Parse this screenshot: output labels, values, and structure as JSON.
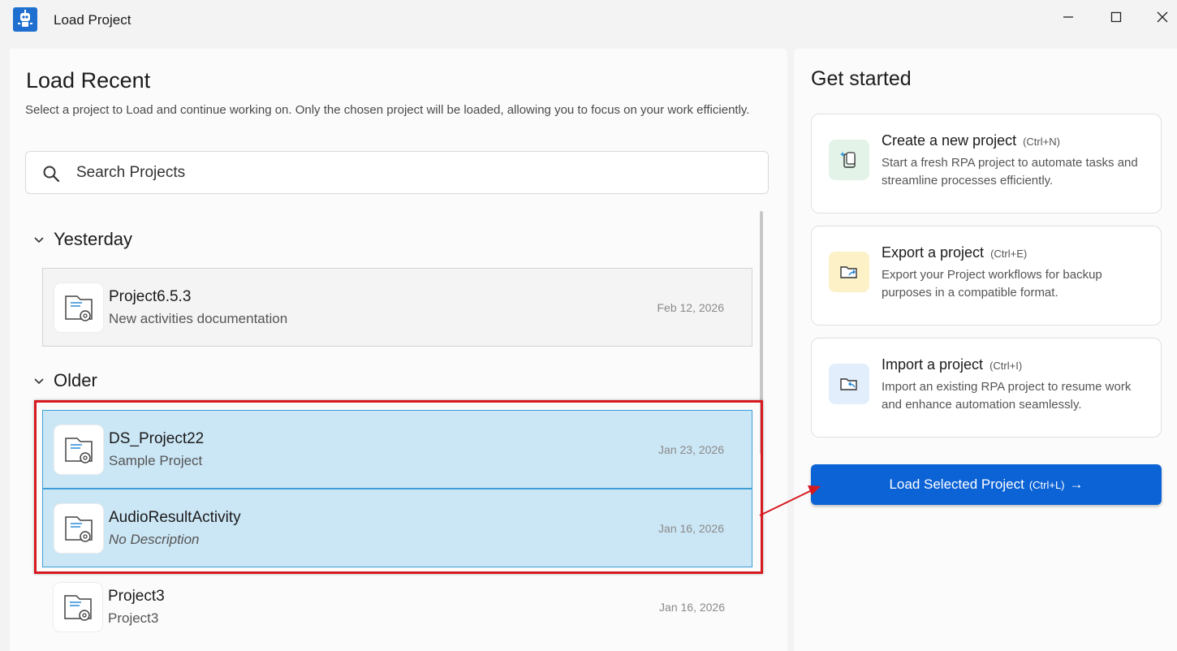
{
  "window": {
    "title": "Load Project"
  },
  "left": {
    "heading": "Load Recent",
    "subtitle": "Select a project to Load and continue working on. Only the chosen project will be loaded, allowing you to focus on your work efficiently.",
    "search": {
      "placeholder": "Search Projects",
      "value": ""
    },
    "groups": [
      {
        "label": "Yesterday",
        "items": [
          {
            "name": "Project6.5.3",
            "description": "New activities documentation",
            "date": "Feb 12, 2026",
            "state": "hover"
          }
        ]
      },
      {
        "label": "Older",
        "items": [
          {
            "name": "DS_Project22",
            "description": "Sample Project",
            "date": "Jan 23, 2026",
            "state": "selected"
          },
          {
            "name": "AudioResultActivity",
            "description": "No Description",
            "date": "Jan 16, 2026",
            "state": "selected"
          },
          {
            "name": "Project3",
            "description": "Project3",
            "date": "Jan 16, 2026",
            "state": "normal"
          }
        ]
      }
    ]
  },
  "right": {
    "heading": "Get started",
    "cards": [
      {
        "title": "Create a new project",
        "shortcut": "(Ctrl+N)",
        "description": "Start a fresh RPA project to automate tasks and streamline processes efficiently.",
        "icon": "new-project-icon",
        "tile_color": "#e3f3e8"
      },
      {
        "title": "Export a project",
        "shortcut": "(Ctrl+E)",
        "description": "Export your Project workflows for backup purposes in a compatible format.",
        "icon": "export-folder-icon",
        "tile_color": "#fdf1c8"
      },
      {
        "title": "Import a project",
        "shortcut": "(Ctrl+I)",
        "description": "Import an existing RPA project to resume work and enhance automation seamlessly.",
        "icon": "import-folder-icon",
        "tile_color": "#e2eefc"
      }
    ],
    "load_button": {
      "label": "Load Selected Project",
      "shortcut": "(Ctrl+L)",
      "arrow": "→"
    }
  },
  "colors": {
    "accent": "#0c63d6",
    "selected_bg": "#cbe6f5",
    "selected_border": "#3d9fd6",
    "annotation_red": "#d71920"
  }
}
